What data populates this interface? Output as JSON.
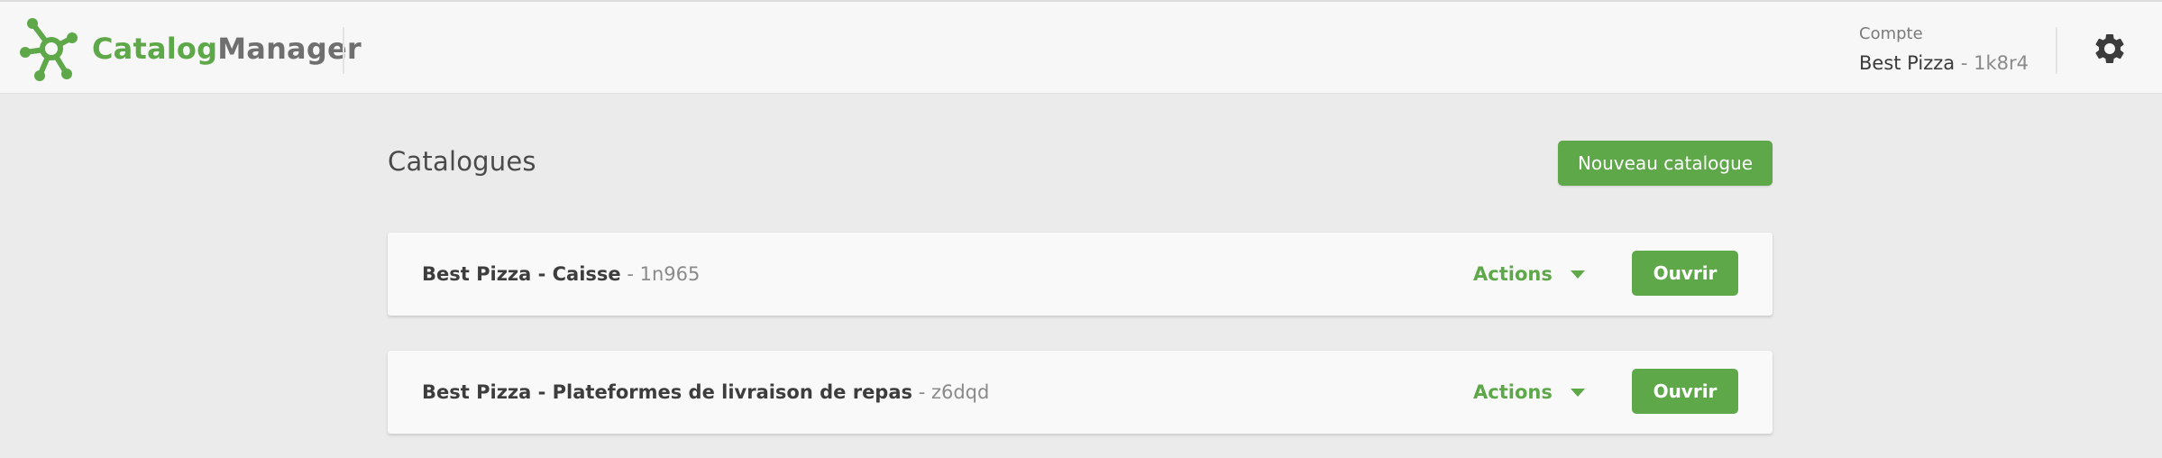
{
  "app": {
    "brand_part1": "Catalog",
    "brand_part2": "Manager",
    "logo_icon": "network-node-icon",
    "accent_color": "#5ea84a"
  },
  "account": {
    "label": "Compte",
    "name": "Best Pizza",
    "separator": "-",
    "id": "1k8r4"
  },
  "settings": {
    "icon": "gear-icon"
  },
  "main": {
    "title": "Catalogues",
    "new_button_label": "Nouveau catalogue"
  },
  "catalogs": [
    {
      "name": "Best Pizza - Caisse",
      "separator": "-",
      "id": "1n965",
      "actions_label": "Actions",
      "open_label": "Ouvrir"
    },
    {
      "name": "Best Pizza - Plateformes de livraison de repas",
      "separator": "-",
      "id": "z6dqd",
      "actions_label": "Actions",
      "open_label": "Ouvrir"
    }
  ]
}
